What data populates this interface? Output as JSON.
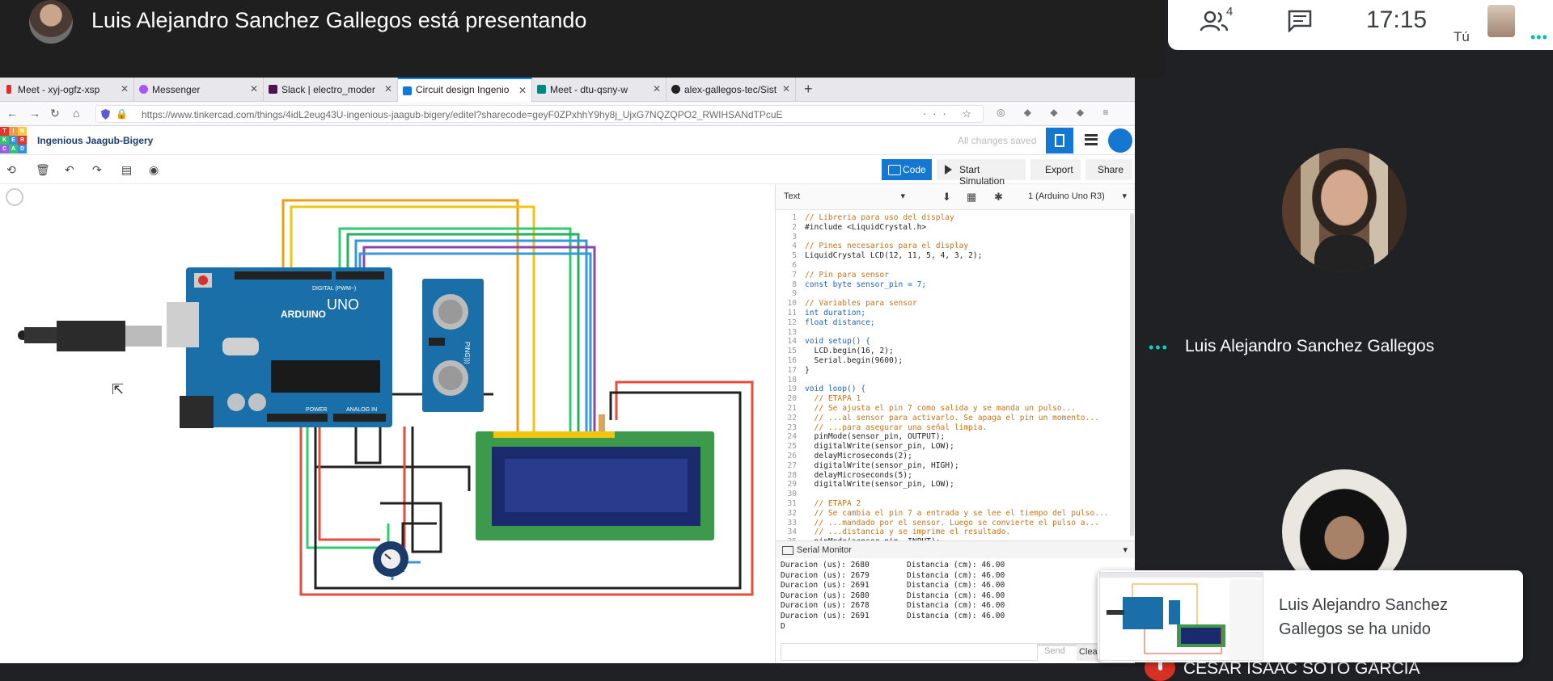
{
  "presenter": {
    "title": "Luis Alejandro Sanchez Gallegos está presentando"
  },
  "meet_bar": {
    "people_count": "4",
    "clock": "17:15",
    "self_label": "Tú"
  },
  "browser": {
    "tabs": [
      {
        "label": "Meet - xyj-ogfz-xsp",
        "color": "#d93025"
      },
      {
        "label": "Messenger",
        "color": "#a855f7"
      },
      {
        "label": "Slack | electro_moder",
        "color": "#4a154b"
      },
      {
        "label": "Circuit design Ingenio",
        "color": "#1477d1"
      },
      {
        "label": "Meet - dtu-qsny-w",
        "color": "#00897b"
      },
      {
        "label": "alex-gallegos-tec/Sist",
        "color": "#222222"
      }
    ],
    "url": "https://www.tinkercad.com/things/4idL2eug43U-ingenious-jaagub-bigery/editel?sharecode=geyF0ZPxhhY9hy8j_UjxG7NQZQPO2_RWIHSANdTPcuE"
  },
  "tinkercad": {
    "logo_letters": [
      "T",
      "I",
      "N",
      "K",
      "E",
      "R",
      "C",
      "A",
      "D"
    ],
    "project_name": "Ingenious Jaagub-Bigery",
    "save_status": "All changes saved",
    "code_label": "Code",
    "simulation_label": "Start Simulation",
    "export_label": "Export",
    "share_label": "Share"
  },
  "code_panel": {
    "mode": "Text",
    "device": "1 (Arduino Uno R3)",
    "line_numbers": [
      "1",
      "2",
      "3",
      "4",
      "5",
      "6",
      "7",
      "8",
      "9",
      "10",
      "11",
      "12",
      "13",
      "14",
      "15",
      "16",
      "17",
      "18",
      "19",
      "20",
      "21",
      "22",
      "23",
      "24",
      "25",
      "26",
      "27",
      "28",
      "29",
      "30",
      "31",
      "32",
      "33",
      "34",
      "35"
    ],
    "lines": [
      "// Libreria para uso del display",
      "#include <LiquidCrystal.h>",
      "",
      "// Pines necesarios para el display",
      "LiquidCrystal LCD(12, 11, 5, 4, 3, 2);",
      "",
      "// Pin para sensor",
      "const byte sensor_pin = 7;",
      "",
      "// Variables para sensor",
      "int duration;",
      "float distance;",
      "",
      "void setup() {",
      "  LCD.begin(16, 2);",
      "  Serial.begin(9600);",
      "}",
      "",
      "void loop() {",
      "  // ETAPA 1",
      "  // Se ajusta el pin 7 como salida y se manda un pulso...",
      "  // ...al sensor para activarlo. Se apaga el pin un momento...",
      "  // ...para asegurar una señal limpia.",
      "  pinMode(sensor_pin, OUTPUT);",
      "  digitalWrite(sensor_pin, LOW);",
      "  delayMicroseconds(2);",
      "  digitalWrite(sensor_pin, HIGH);",
      "  delayMicroseconds(5);",
      "  digitalWrite(sensor_pin, LOW);",
      "",
      "  // ETAPA 2",
      "  // Se cambia el pin 7 a entrada y se lee el tiempo del pulso...",
      "  // ...mandado por el sensor. Luego se convierte el pulso a...",
      "  // ...distancia y se imprime el resultado.",
      "  pinMode(sensor_pin, INPUT);"
    ],
    "serial_title": "Serial Monitor",
    "serial_lines": [
      "Duracion (us): 2680        Distancia (cm): 46.00",
      "Duracion (us): 2679        Distancia (cm): 46.00",
      "Duracion (us): 2691        Distancia (cm): 46.00",
      "Duracion (us): 2680        Distancia (cm): 46.00",
      "Duracion (us): 2678        Distancia (cm): 46.00",
      "Duracion (us): 2691        Distancia (cm): 46.00",
      "D"
    ],
    "send_label": "Send",
    "clear_label": "Clear"
  },
  "circuit": {
    "board_brand": "ARDUINO",
    "board_model": "UNO",
    "digital_label": "DIGITAL (PWM~)",
    "power_label": "POWER",
    "analog_label": "ANALOG IN",
    "sensor_label": "PING)))"
  },
  "participants": {
    "speaker_name": "Luis Alejandro Sanchez Gallegos",
    "toast_text": "Luis Alejandro Sanchez Gallegos se ha unido",
    "bottom_name": "CESAR ISAAC SOTO GARCIA"
  }
}
